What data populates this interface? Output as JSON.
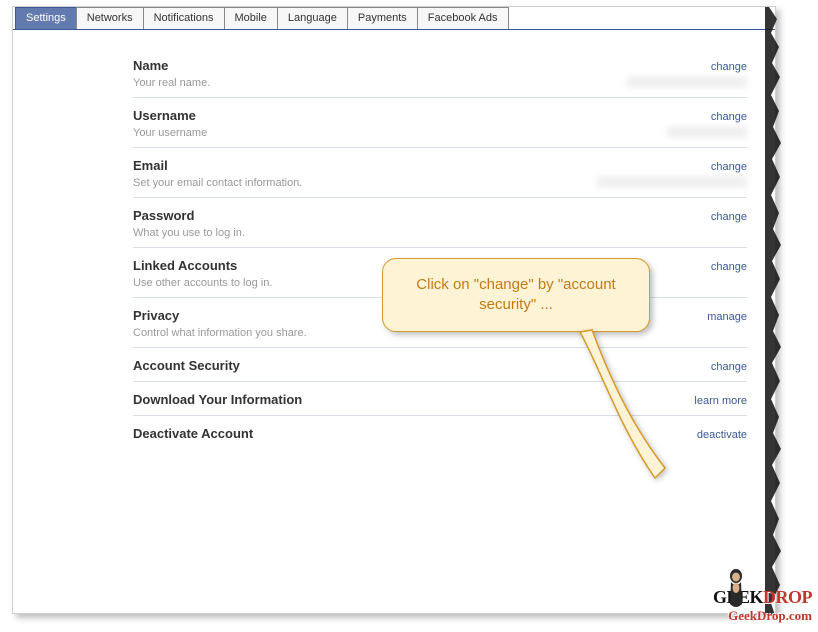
{
  "tabs": [
    {
      "label": "Settings",
      "active": true
    },
    {
      "label": "Networks"
    },
    {
      "label": "Notifications"
    },
    {
      "label": "Mobile"
    },
    {
      "label": "Language"
    },
    {
      "label": "Payments"
    },
    {
      "label": "Facebook Ads"
    }
  ],
  "rows": [
    {
      "title": "Name",
      "desc": "Your real name.",
      "action": "change",
      "blur": true
    },
    {
      "title": "Username",
      "desc": "Your username",
      "action": "change",
      "blur": true
    },
    {
      "title": "Email",
      "desc": "Set your email contact information.",
      "action": "change",
      "blur": true
    },
    {
      "title": "Password",
      "desc": "What you use to log in.",
      "action": "change",
      "blur": false
    },
    {
      "title": "Linked Accounts",
      "desc": "Use other accounts to log in.",
      "action": "change",
      "blur": false
    },
    {
      "title": "Privacy",
      "desc": "Control what information you share.",
      "action": "manage",
      "blur": false
    },
    {
      "title": "Account Security",
      "desc": "",
      "action": "change",
      "blur": false
    },
    {
      "title": "Download Your Information",
      "desc": "",
      "action": "learn more",
      "blur": false
    },
    {
      "title": "Deactivate Account",
      "desc": "",
      "action": "deactivate",
      "blur": false
    }
  ],
  "callout": {
    "text": "Click on \"change\" by \"account security\" ..."
  },
  "watermark": {
    "brand_a": "GEEK",
    "brand_b": "DROP",
    "url": "GeekDrop.com"
  }
}
